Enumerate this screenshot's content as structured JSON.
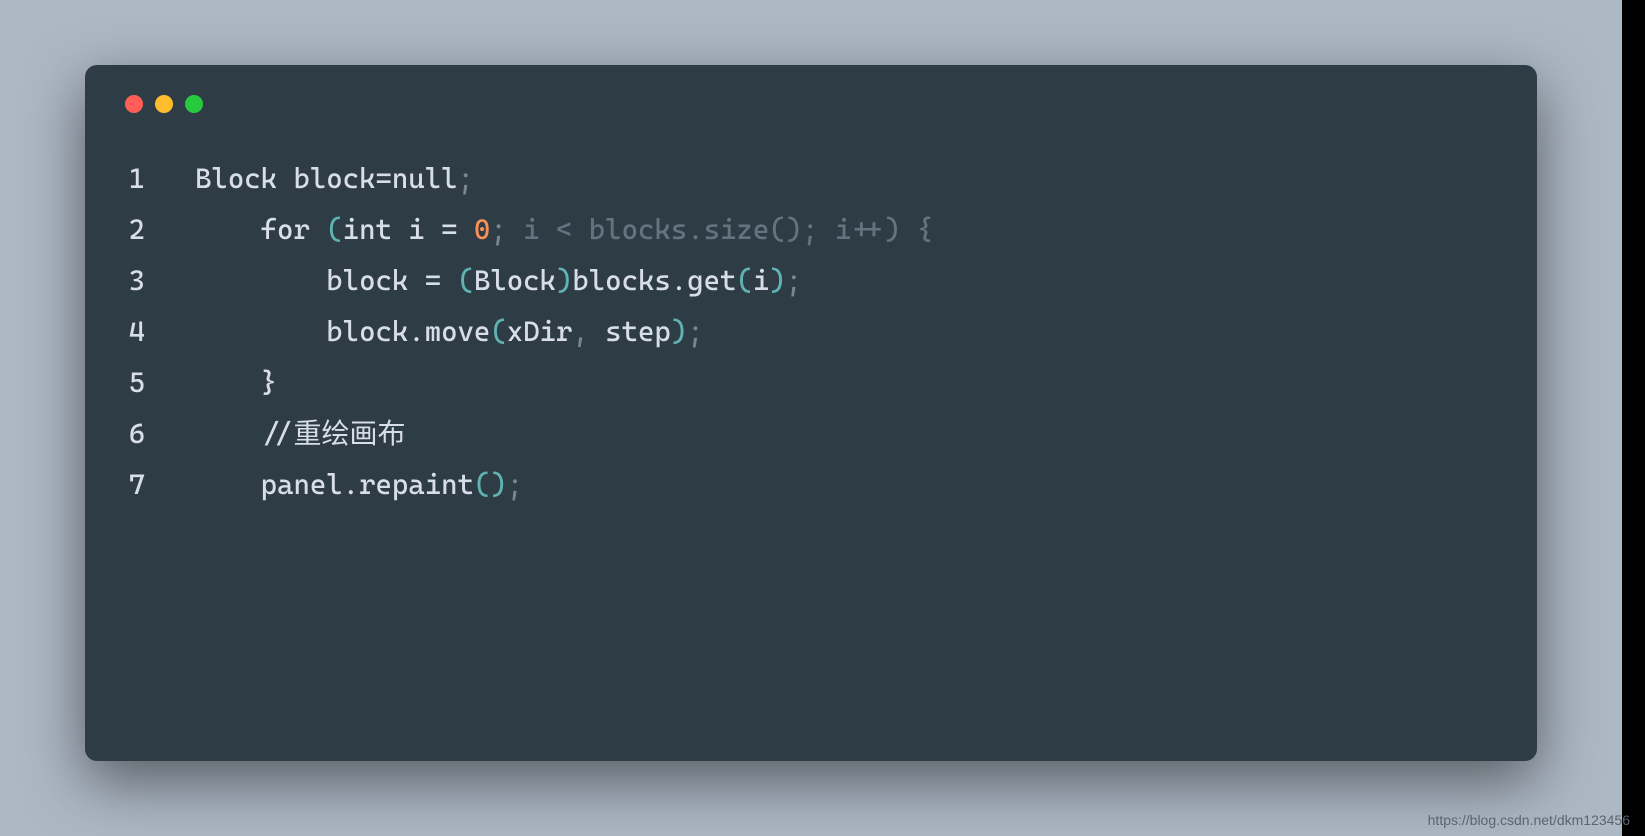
{
  "lineNumbers": [
    "1",
    "2",
    "3",
    "4",
    "5",
    "6",
    "7"
  ],
  "code": {
    "line1": {
      "type": "Block",
      "space1": " ",
      "var": "block",
      "eq": "=",
      "null": "null",
      "semi": ";"
    },
    "line2": {
      "indent": "    ",
      "for": "for",
      "space1": " ",
      "lparen": "(",
      "int": "int",
      "space2": " ",
      "i": "i",
      "space3": " ",
      "eq": "=",
      "space4": " ",
      "zero": "0",
      "semi1": ";",
      "rest": " i < blocks.size(); i++) {"
    },
    "line3": {
      "indent": "        ",
      "block": "block",
      "space1": " ",
      "eq": "=",
      "space2": " ",
      "lparen": "(",
      "cast": "Block",
      "rparen": ")",
      "blocks": "blocks",
      "dot": ".",
      "get": "get",
      "lparen2": "(",
      "i": "i",
      "rparen2": ")",
      "semi": ";"
    },
    "line4": {
      "indent": "        ",
      "block": "block",
      "dot": ".",
      "move": "move",
      "lparen": "(",
      "xdir": "xDir",
      "comma": ",",
      "space": " ",
      "step": "step",
      "rparen": ")",
      "semi": ";"
    },
    "line5": {
      "indent": "    ",
      "brace": "}"
    },
    "line6": {
      "indent": "    ",
      "comment": "//重绘画布"
    },
    "line7": {
      "indent": "    ",
      "panel": "panel",
      "dot": ".",
      "repaint": "repaint",
      "lparen": "(",
      "rparen": ")",
      "semi": ";"
    }
  },
  "watermark": "https://blog.csdn.net/dkm123456"
}
